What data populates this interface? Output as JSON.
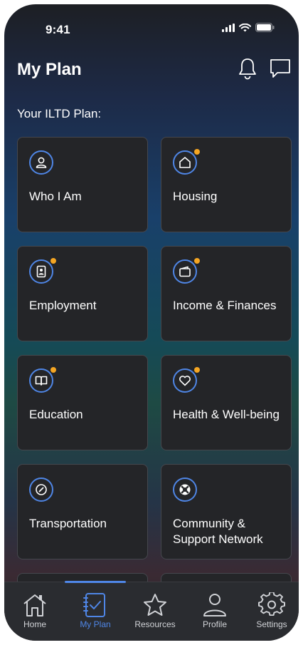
{
  "status_bar": {
    "time": "9:41"
  },
  "header": {
    "title": "My Plan"
  },
  "section_label": "Your ILTD Plan:",
  "cards": [
    {
      "label": "Who I Am",
      "icon": "person-icon",
      "has_dot": false
    },
    {
      "label": "Housing",
      "icon": "house-icon",
      "has_dot": true
    },
    {
      "label": "Employment",
      "icon": "id-badge-icon",
      "has_dot": true
    },
    {
      "label": "Income & Finances",
      "icon": "wallet-icon",
      "has_dot": true
    },
    {
      "label": "Education",
      "icon": "book-icon",
      "has_dot": true
    },
    {
      "label": "Health & Well-being",
      "icon": "heart-icon",
      "has_dot": true
    },
    {
      "label": "Transportation",
      "icon": "compass-icon",
      "has_dot": false
    },
    {
      "label": "Community & Support Network",
      "icon": "lifebuoy-icon",
      "has_dot": false
    }
  ],
  "tabbar": {
    "tabs": [
      {
        "label": "Home",
        "icon": "home-icon",
        "active": false
      },
      {
        "label": "My Plan",
        "icon": "checklist-icon",
        "active": true
      },
      {
        "label": "Resources",
        "icon": "star-icon",
        "active": false
      },
      {
        "label": "Profile",
        "icon": "profile-icon",
        "active": false
      },
      {
        "label": "Settings",
        "icon": "gear-icon",
        "active": false
      }
    ]
  },
  "colors": {
    "accent": "#4f86e6",
    "notification_dot": "#f5a623",
    "card_bg": "#242528",
    "tabbar_bg": "#2a2c30"
  }
}
